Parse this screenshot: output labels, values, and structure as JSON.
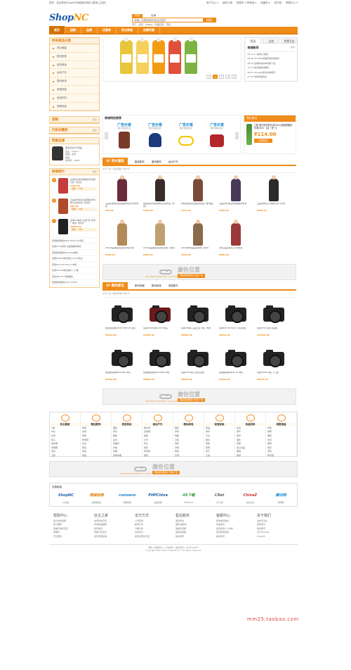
{
  "topbar": {
    "welcome": "您好，欢迎来到ShopNC商城演示网站 [登录] [注册]",
    "links": [
      "用户中心 ▾",
      "我的订单",
      "购物车 0 种商品 ▾",
      "收藏夹 ▾",
      "站内信",
      "帮助中心 ▾"
    ]
  },
  "logo": {
    "part1": "Shop",
    "part2": "NC"
  },
  "search": {
    "tabs": [
      "商品",
      "店铺"
    ],
    "placeholder": "请输入您要搜索的商品关键字",
    "button": "搜索",
    "hot": [
      "李宁",
      "耐克",
      "Kappa",
      "阿迪达斯",
      "背包"
    ]
  },
  "nav": [
    "首页",
    "团购",
    "品牌",
    "优惠券",
    "积分商城",
    "店铺专题"
  ],
  "sidebar": {
    "title": "所有商品分类",
    "more": "更多",
    "items": [
      "男女服装",
      "鞋包配饰",
      "美容美妆",
      "运动户外",
      "数码家电",
      "家居家装",
      "食品饮料",
      "母婴用品"
    ]
  },
  "banner": {
    "pages": [
      "1",
      "2",
      "3",
      "4",
      "5"
    ],
    "active_page": "2"
  },
  "notice": {
    "tabs": [
      "登录",
      "注册",
      "免费开店"
    ],
    "title": "商城新闻",
    "more": "更多",
    "items": [
      "2.1版本上线啦",
      "ShopNC店铺商城系统发布",
      "店铺商城基本功能介绍",
      "新功能敬请期待",
      "ShopNC官方商城项目",
      "商城功能完善"
    ],
    "dates": [
      "09-11",
      "09-09",
      "08-18",
      "12-12",
      "08-01",
      "07-20"
    ]
  },
  "promo": {
    "title": "商城特别推荐",
    "ads": [
      {
        "title": "广告示意",
        "sub": "图片描述信息"
      },
      {
        "title": "广告示意",
        "sub": "图片描述信息"
      },
      {
        "title": "广告示意",
        "sub": "图片描述信息"
      },
      {
        "title": "广告示意",
        "sub": "图片描述信息"
      }
    ],
    "prev": "‹",
    "next": "›"
  },
  "special": {
    "header": "特价商品",
    "name": "兰蔻 美白修护精华液30ml/透明质酸精华液30ml 【买一送一】",
    "price": "¥114.00",
    "buy": "立即购买"
  },
  "left_boxes": {
    "groupbuy": "团购",
    "coupon": "打折优惠券",
    "stores": "明星店铺",
    "rank": "热销排行",
    "more": "更多"
  },
  "store_info": [
    "潮流运动户外用品",
    "店主：shopnc",
    "店铺：北京",
    "信用：",
    "好评率：100%"
  ],
  "rank": {
    "top": [
      {
        "n": "1",
        "name": "女装秋冬新款韩版修身毛呢外套【清仓】",
        "price": "¥108.00",
        "sold": "销量：23件"
      },
      {
        "n": "2",
        "name": "正品新款秋冬女装韩版羊毛呢大衣中长款【清仓】",
        "price": "¥98.00",
        "sold": "销量：29件"
      },
      {
        "n": "3",
        "name": "尼康D3单机 正品行货 带原厂电池【清仓】",
        "price": "¥9800.00",
        "sold": "销量：18件"
      }
    ],
    "small": [
      "佳能数码相机EOS 550D Kit 套机",
      "尼康D700套机 全画幅数码单反",
      "佳能数码相机EOS 60D单机",
      "尼康D5000单反套机 18-55镜头",
      "佳能EOS 5D Mark II 单机",
      "尼康D3100单反相机 入门级",
      "索尼NEX-5C 微单相机",
      "佳能数码相机IXUS 220HS"
    ]
  },
  "floor1": {
    "title": "1F 男女服装",
    "tabs": [
      "服装配饰",
      "潮流服饰",
      "运动户外"
    ],
    "sub": "文字广告 | 男女服装广告文字",
    "products": [
      {
        "name": "正品新款秋冬女装韩版羊毛呢大衣中长款",
        "price": "¥58.00"
      },
      {
        "name": "女装秋冬新款韩版修身毛呢外套【清仓】",
        "price": "¥108.00"
      },
      {
        "name": "时尚潮流修身显瘦毛衣女装 T恤 精选",
        "price": "¥131.00"
      },
      {
        "name": "正品新款冬装加厚羽绒服中长款",
        "price": "¥398.00"
      },
      {
        "name": "正品时尚呢子大衣修身款【清仓】",
        "price": "¥398.00"
      },
      {
        "name": "2011新品韩版女装秋冬外套大衣",
        "price": "¥380.00"
      },
      {
        "name": "2011新品韩版女装秋冬风衣【清仓】",
        "price": "¥298.00"
      },
      {
        "name": "2011秋季新品女装棉衣【清仓】",
        "price": "¥438.00"
      },
      {
        "name": "新款正品女装呢子大衣秋冬",
        "price": "¥680.00"
      }
    ]
  },
  "floor2": {
    "title": "2F 数码家电",
    "tabs": [
      "家用电器",
      "数码影音",
      "电脑配件"
    ],
    "sub": "文字广告 | 数码家电广告文字",
    "products": [
      {
        "name": "佳能单反相机 EOS 550D Kit 套机",
        "price": "¥4999.00"
      },
      {
        "name": "尼康D3100套机 18-55镜头",
        "price": "¥3988.00"
      },
      {
        "name": "尼康D3单机 正品行货 带原厂电池",
        "price": "¥9800.00"
      },
      {
        "name": "佳能EOS 5D Mark II 专业单反",
        "price": "¥5999.00"
      },
      {
        "name": "尼康D700 套机 全画幅",
        "price": "¥12999.00"
      },
      {
        "name": "佳能数码相机EOS 60D 单机",
        "price": "¥5200.00"
      },
      {
        "name": "佳能数码相机EOS 600D 单机",
        "price": "¥6888.00"
      },
      {
        "name": "尼康D3X 单机 专业全画幅",
        "price": "¥8999.00"
      },
      {
        "name": "佳能数码相机EOS 7D 单机",
        "price": "¥4999.00"
      },
      {
        "name": "尼康D5100 单反 入门级",
        "price": "¥5576.00"
      }
    ]
  },
  "adband": {
    "title": "廣告位置",
    "sub": "ADVERTISEMENT LAYOUT",
    "tag": "网站首页楼层广告位广告"
  },
  "category_blocks": [
    {
      "t": "男女服装",
      "items": [
        "T恤",
        "衬衫",
        "外套",
        "裤子",
        "连衣裙",
        "羽绒服",
        "风衣",
        "卫衣"
      ]
    },
    {
      "t": "鞋包配饰",
      "items": [
        "单鞋",
        "女靴",
        "男鞋",
        "休闲鞋",
        "女包",
        "男包",
        "钱包",
        "饰品"
      ]
    },
    {
      "t": "美容美妆",
      "items": [
        "面膜",
        "香水",
        "眼霜",
        "彩妆",
        "洗面奶",
        "护肤",
        "防晒",
        "身体护理"
      ]
    },
    {
      "t": "运动户外",
      "items": [
        "跑步鞋",
        "运动服",
        "篮球",
        "户外",
        "登山",
        "游泳",
        "羽毛球",
        "健身"
      ]
    },
    {
      "t": "数码家电",
      "items": [
        "相机",
        "手机",
        "电脑",
        "平板",
        "耳机",
        "音响",
        "电视",
        "空调"
      ]
    },
    {
      "t": "家居家装",
      "items": [
        "床品",
        "家具",
        "灯具",
        "厨具",
        "收纳",
        "装饰",
        "布艺",
        "卫浴"
      ]
    },
    {
      "t": "食品饮料",
      "items": [
        "零食",
        "茶叶",
        "饮料",
        "酒水",
        "坚果",
        "进口食品",
        "粮油",
        "保健"
      ]
    },
    {
      "t": "母婴用品",
      "items": [
        "奶粉",
        "尿裤",
        "童装",
        "玩具",
        "童鞋",
        "喂养",
        "洗护",
        "孕妇装"
      ]
    }
  ],
  "links": {
    "title": "友情链接",
    "logos": [
      "ShopNC",
      "网城创想",
      "comsenz",
      "PHPChina",
      "A5下载",
      "CNet",
      "ChinaZ",
      "腾讯网"
    ],
    "names": [
      "CG富豪",
      "康佳酷图王",
      "网城创想",
      "康盛创想",
      "PHPChina",
      "A5下载",
      "站长之家",
      "腾讯网"
    ]
  },
  "help": [
    {
      "t": "帮助中心",
      "items": [
        "积分兑换说明",
        "积分细则",
        "查看已购买宝贝",
        "我要买",
        "忘记密码"
      ]
    },
    {
      "t": "店主之家",
      "items": [
        "如何申请开店",
        "商城商品推荐",
        "如何发货",
        "查看已售宝贝",
        "如何管理店铺"
      ]
    },
    {
      "t": "支付方式",
      "items": [
        "公司转账",
        "邮局汇款",
        "分期付款",
        "在线支付",
        "如何注册支付宝"
      ]
    },
    {
      "t": "售后服务",
      "items": [
        "退款申请",
        "返修/退换货",
        "退换货流程",
        "退换货政策",
        "联系卖家"
      ]
    },
    {
      "t": "客服中心",
      "items": [
        "修改收货地址",
        "商品发布",
        "会员修改个人资料",
        "会员修改密码",
        "联系我们"
      ]
    },
    {
      "t": "关于我们",
      "items": [
        "合作及洽谈",
        "招聘英才",
        "联系我们",
        "关于ShopNC",
        "ShopNC"
      ]
    }
  ],
  "footer": {
    "links": "首页 | 招聘英才 | 广告合作 | 联系我们 | 关于ShopNC",
    "copy": "Copyright 2007-2012 ShopNC Inc. All rights reserved."
  },
  "watermark": "mm25.taobao.com",
  "colors": {
    "accent": "#f08c1a",
    "brand": "#1d5ea8"
  }
}
